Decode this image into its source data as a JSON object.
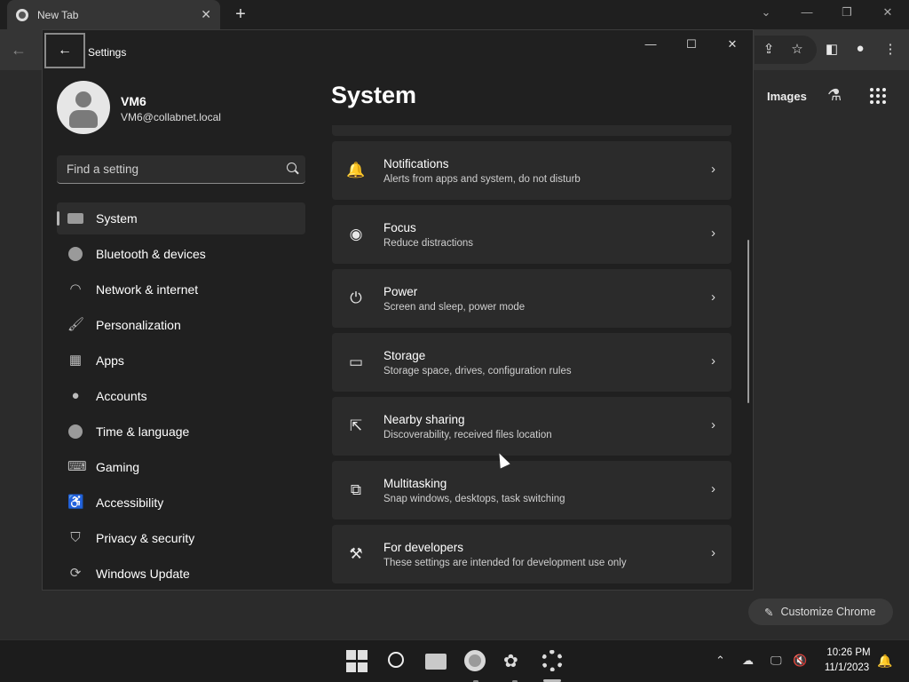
{
  "browser": {
    "tab_title": "New Tab",
    "tab_close": "✕",
    "new_tab": "+",
    "images_link": "Images",
    "customize_label": "Customize Chrome"
  },
  "settings": {
    "app_title": "Settings",
    "user": {
      "name": "VM6",
      "email": "VM6@collabnet.local"
    },
    "search_placeholder": "Find a setting",
    "page_title": "System",
    "nav": [
      {
        "label": "System",
        "icon": "monitor-icon",
        "active": true
      },
      {
        "label": "Bluetooth & devices",
        "icon": "bluetooth-icon"
      },
      {
        "label": "Network & internet",
        "icon": "wifi-icon"
      },
      {
        "label": "Personalization",
        "icon": "brush-icon"
      },
      {
        "label": "Apps",
        "icon": "apps-icon"
      },
      {
        "label": "Accounts",
        "icon": "person-icon"
      },
      {
        "label": "Time & language",
        "icon": "globe-clock-icon"
      },
      {
        "label": "Gaming",
        "icon": "gamepad-icon"
      },
      {
        "label": "Accessibility",
        "icon": "accessibility-icon"
      },
      {
        "label": "Privacy & security",
        "icon": "shield-icon"
      },
      {
        "label": "Windows Update",
        "icon": "update-icon"
      }
    ],
    "cards": [
      {
        "title": "Notifications",
        "desc": "Alerts from apps and system, do not disturb",
        "icon": "bell-icon"
      },
      {
        "title": "Focus",
        "desc": "Reduce distractions",
        "icon": "focus-icon"
      },
      {
        "title": "Power",
        "desc": "Screen and sleep, power mode",
        "icon": "power-icon"
      },
      {
        "title": "Storage",
        "desc": "Storage space, drives, configuration rules",
        "icon": "storage-icon"
      },
      {
        "title": "Nearby sharing",
        "desc": "Discoverability, received files location",
        "icon": "share-icon"
      },
      {
        "title": "Multitasking",
        "desc": "Snap windows, desktops, task switching",
        "icon": "multitask-icon"
      },
      {
        "title": "For developers",
        "desc": "These settings are intended for development use only",
        "icon": "developer-tools-icon"
      }
    ]
  },
  "taskbar": {
    "time": "10:26 PM",
    "date": "11/1/2023"
  }
}
